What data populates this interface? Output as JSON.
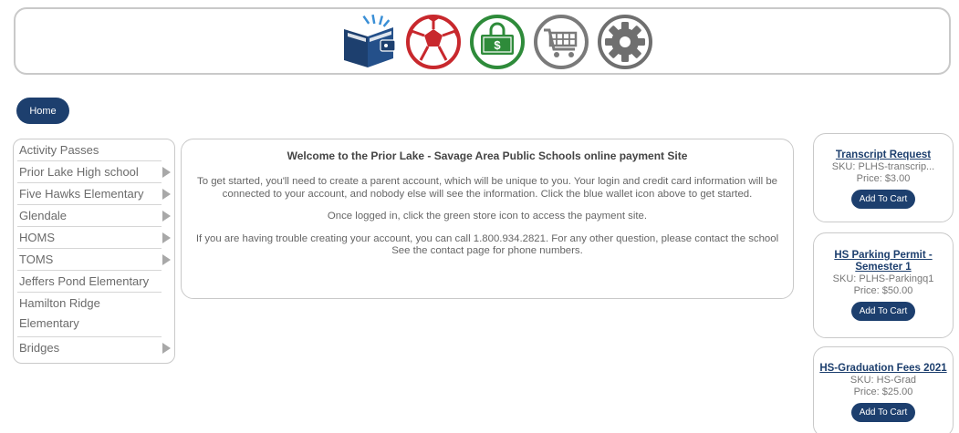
{
  "header": {
    "icons": [
      {
        "name": "wallet-icon",
        "color": "#1d3f6e"
      },
      {
        "name": "soccer-ball-icon",
        "color": "#c8282d"
      },
      {
        "name": "money-lock-icon",
        "color": "#2e8b3a"
      },
      {
        "name": "shopping-cart-icon",
        "color": "#777777"
      },
      {
        "name": "gear-icon",
        "color": "#6f6f6f"
      }
    ]
  },
  "nav": {
    "home_label": "Home"
  },
  "sidebar": {
    "items": [
      {
        "label": "Activity Passes"
      },
      {
        "label": "Prior Lake High school"
      },
      {
        "label": "Five Hawks Elementary"
      },
      {
        "label": "Glendale"
      },
      {
        "label": "HOMS"
      },
      {
        "label": "TOMS"
      },
      {
        "label": "Jeffers Pond Elementary"
      },
      {
        "label": "Hamilton Ridge Elementary"
      },
      {
        "label": "Bridges"
      }
    ]
  },
  "welcome": {
    "title": "Welcome to the Prior Lake - Savage Area Public Schools online payment Site",
    "paragraph1": "To get started, you'll need to create a parent account, which will be unique to you. Your login and credit card information will be connected to your account, and nobody else will see the information. Click the blue wallet icon above to get started.",
    "paragraph2": "Once logged in, click the green store icon to access the payment site.",
    "paragraph3": "If you are having trouble creating your account, you can call 1.800.934.2821. For any other question, please contact the school See the contact page for phone numbers."
  },
  "products": [
    {
      "name": "Transcript Request",
      "sku": "SKU:  PLHS-transcrip...",
      "price": "Price: $3.00",
      "button": "Add To Cart"
    },
    {
      "name": "HS Parking Permit - Semester 1",
      "sku": "SKU:  PLHS-Parkingq1",
      "price": "Price: $50.00",
      "button": "Add To Cart"
    },
    {
      "name": "HS-Graduation Fees 2021",
      "sku": "SKU:  HS-Grad",
      "price": "Price: $25.00",
      "button": "Add To Cart"
    }
  ],
  "colors": {
    "brand": "#1d3f6e",
    "border": "#c9c9c9"
  }
}
